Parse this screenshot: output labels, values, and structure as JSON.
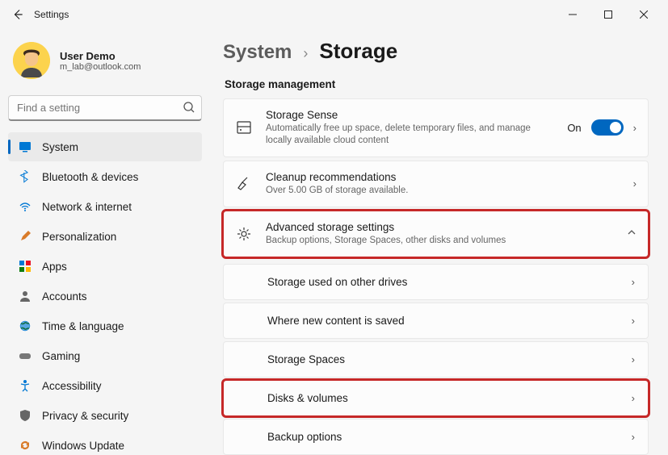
{
  "window": {
    "title": "Settings"
  },
  "profile": {
    "name": "User Demo",
    "email": "m_lab@outlook.com"
  },
  "search": {
    "placeholder": "Find a setting"
  },
  "sidebar": {
    "items": [
      {
        "label": "System"
      },
      {
        "label": "Bluetooth & devices"
      },
      {
        "label": "Network & internet"
      },
      {
        "label": "Personalization"
      },
      {
        "label": "Apps"
      },
      {
        "label": "Accounts"
      },
      {
        "label": "Time & language"
      },
      {
        "label": "Gaming"
      },
      {
        "label": "Accessibility"
      },
      {
        "label": "Privacy & security"
      },
      {
        "label": "Windows Update"
      }
    ]
  },
  "breadcrumb": {
    "parent": "System",
    "current": "Storage"
  },
  "section": {
    "heading": "Storage management"
  },
  "cards": {
    "sense": {
      "title": "Storage Sense",
      "sub": "Automatically free up space, delete temporary files, and manage locally available cloud content",
      "state": "On"
    },
    "cleanup": {
      "title": "Cleanup recommendations",
      "sub": "Over 5.00 GB of storage available."
    },
    "advanced": {
      "title": "Advanced storage settings",
      "sub": "Backup options, Storage Spaces, other disks and volumes"
    }
  },
  "advanced_sub": [
    {
      "label": "Storage used on other drives"
    },
    {
      "label": "Where new content is saved"
    },
    {
      "label": "Storage Spaces"
    },
    {
      "label": "Disks & volumes"
    },
    {
      "label": "Backup options"
    }
  ]
}
